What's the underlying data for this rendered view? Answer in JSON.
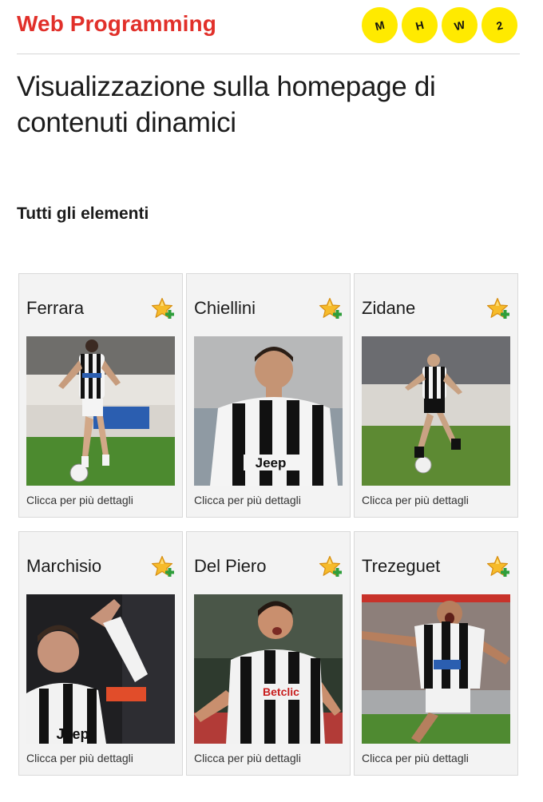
{
  "header": {
    "brand": "Web Programming",
    "badges": [
      "M",
      "H",
      "W",
      "2"
    ]
  },
  "page": {
    "title": "Visualizzazione sulla homepage di contenuti dinamici",
    "section_title": "Tutti gli elementi"
  },
  "cards": [
    {
      "name": "Ferrara",
      "link": "Clicca per più dettagli",
      "icon": "star-plus-icon"
    },
    {
      "name": "Chiellini",
      "link": "Clicca per più dettagli",
      "icon": "star-plus-icon"
    },
    {
      "name": "Zidane",
      "link": "Clicca per più dettagli",
      "icon": "star-plus-icon"
    },
    {
      "name": "Marchisio",
      "link": "Clicca per più dettagli",
      "icon": "star-plus-icon"
    },
    {
      "name": "Del Piero",
      "link": "Clicca per più dettagli",
      "icon": "star-plus-icon"
    },
    {
      "name": "Trezeguet",
      "link": "Clicca per più dettagli",
      "icon": "star-plus-icon"
    }
  ],
  "colors": {
    "brand": "#e1302a",
    "badge": "#ffea00",
    "card_bg": "#f3f3f3"
  }
}
